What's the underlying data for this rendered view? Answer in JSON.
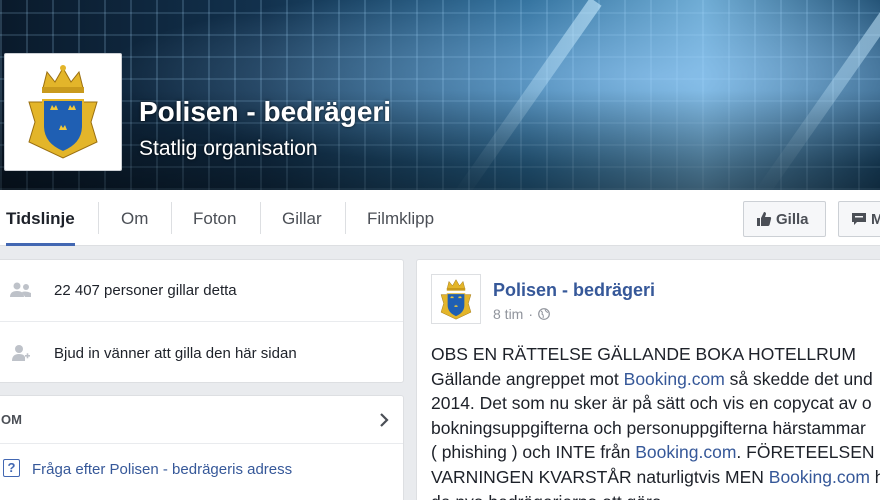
{
  "page": {
    "name": "Polisen - bedrägeri",
    "category": "Statlig organisation"
  },
  "nav": {
    "tabs": [
      "Tidslinje",
      "Om",
      "Foton",
      "Gillar",
      "Filmklipp"
    ],
    "like_button": "Gilla",
    "message_button": "M"
  },
  "sidebar": {
    "likes_text": "22 407 personer gillar detta",
    "invite_text": "Bjud in vänner att gilla den här sidan",
    "about_heading": "OM",
    "ask_address": "Fråga efter Polisen - bedrägeris adress"
  },
  "post": {
    "author": "Polisen - bedrägeri",
    "time": "8 tim",
    "separator": "·",
    "line1": "OBS EN RÄTTELSE GÄLLANDE BOKA HOTELLRUM",
    "line2_pre": "Gällande angreppet mot ",
    "line2_link": "Booking.com",
    "line2_post": " så skedde det und",
    "line3": "2014. Det som nu sker är på sätt och vis en copycat av o",
    "line4": "bokningsuppgifterna och personuppgifterna härstammar",
    "line5_pre": "( phishing ) och INTE från ",
    "line5_link": "Booking.com",
    "line5_post": ". FÖRETEELSEN",
    "line6_pre": "VARNINGEN KVARSTÅR naturligtvis MEN ",
    "line6_link": "Booking.com",
    "line6_post": " h",
    "line7": "de nya bedrägerierna att göra"
  },
  "colors": {
    "brand_blue": "#4267b2",
    "link_blue": "#365899",
    "background": "#e9ebee"
  }
}
